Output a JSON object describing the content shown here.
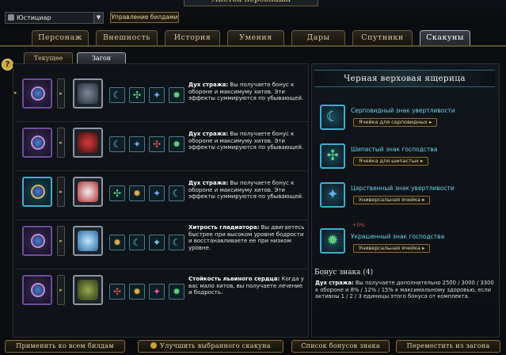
{
  "window": {
    "title": "Листок персонажа"
  },
  "header": {
    "character": "Юстициар",
    "build_button": "Управление билдами"
  },
  "main_tabs": [
    "Персонаж",
    "Внешность",
    "История",
    "Умения",
    "Дары",
    "Спутники",
    "Скакуны"
  ],
  "sub_tabs": [
    "Текущее",
    "Загон"
  ],
  "mounts": [
    {
      "desc_bold": "Дух стража:",
      "desc": " Вы получаете бонус к обороне и максимуму хитов. Эти эффекты суммируются по убывающей."
    },
    {
      "desc_bold": "Дух стража:",
      "desc": " Вы получаете бонус к обороне и максимуму хитов. Эти эффекты суммируются по убывающей."
    },
    {
      "desc_bold": "Дух стража:",
      "desc": " Вы получаете бонус к обороне и максимуму хитов. Эти эффекты суммируются по убывающей."
    },
    {
      "desc_bold": "Хитрость гладиатора:",
      "desc": " Вы двигаетесь быстрее при высоком уровне бодрости и восстанавливаете ее при низком уровне."
    },
    {
      "desc_bold": "Стойкость львиного сердца:",
      "desc": " Когда у вас мало хитов, вы получаете лечение и бодрость."
    }
  ],
  "selected_mount": {
    "name": "Черная верховая ящерица",
    "insignias": [
      {
        "name": "Серповидный знак увертливости",
        "slot": "Ячейка для серповидных ▸"
      },
      {
        "name": "Шипастый знак господства",
        "slot": "Ячейка для шипастых ▸"
      },
      {
        "name": "Царственный знак увертливости",
        "slot": "Универсальная ячейка ▸"
      },
      {
        "name": "Украшенный знак господства",
        "slot": "Универсальная ячейка ▸"
      }
    ],
    "pct": "+0%",
    "bonus_title": "Бонус знака (4)",
    "bonus_bold": "Дух стража:",
    "bonus_text": " Вы получаете дополнительно 2500 / 3000 / 3300 к обороне и 8% / 12% / 15% к максимальному здоровью, если активны 1 / 2 / 3 единицы этого бонуса от комплекта."
  },
  "bottom": {
    "apply_all": "Применить ко всем билдам",
    "upgrade": "Улучшить выбранного скакуна",
    "bonus_list": "Список бонусов знака",
    "move": "Переместить из загона"
  },
  "colors": {
    "accent_gold": "#8a6e33",
    "insignia_cyan": "#3ab0d0",
    "rare_purple": "#6e4da0"
  }
}
